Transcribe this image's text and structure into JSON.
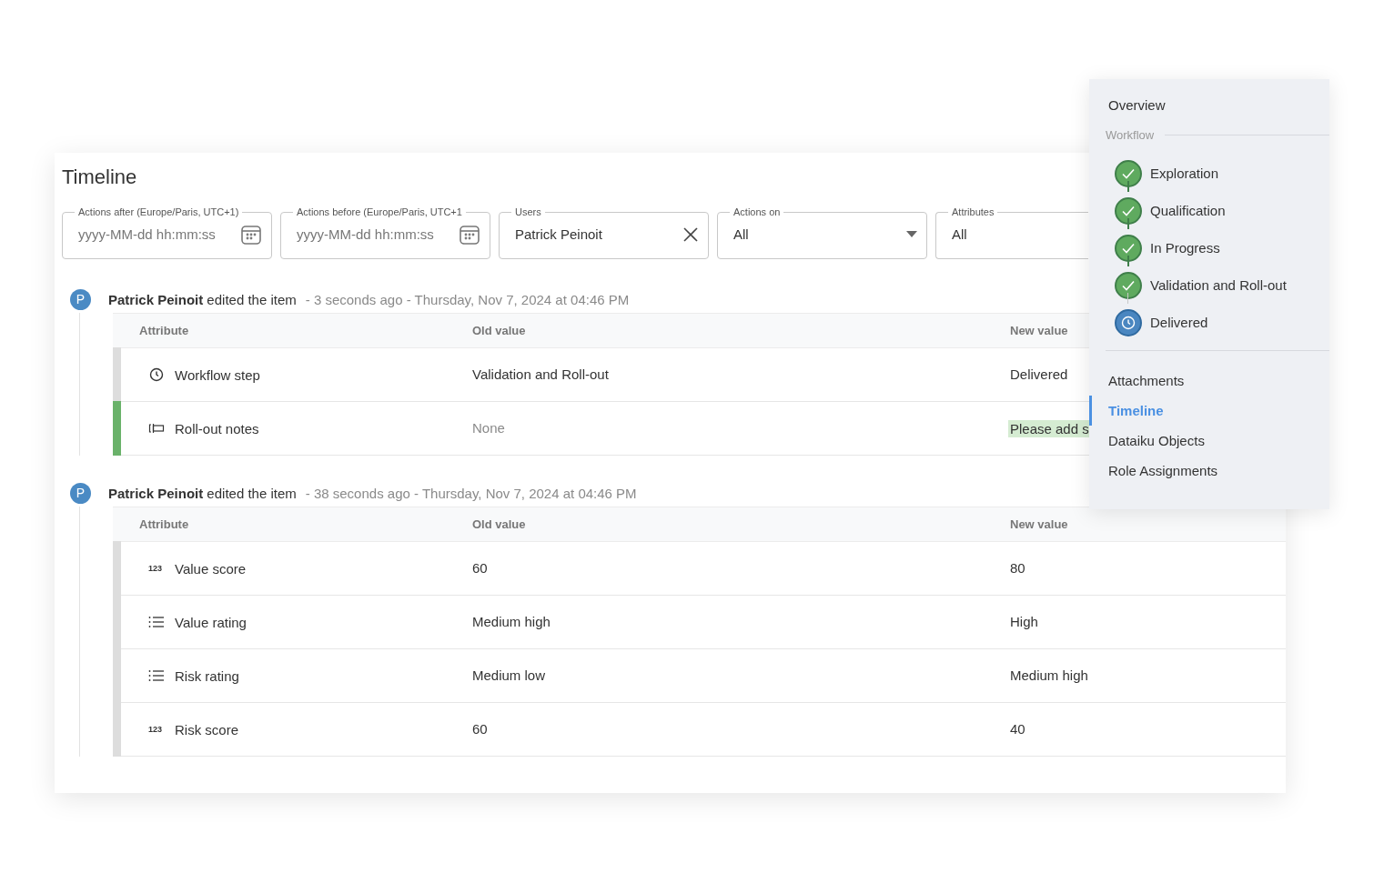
{
  "page_title": "Timeline",
  "filters": [
    {
      "kind": "date",
      "label": "Actions after (Europe/Paris, UTC+1)",
      "placeholder": "yyyy-MM-dd hh:mm:ss"
    },
    {
      "kind": "date",
      "label": "Actions before (Europe/Paris, UTC+1",
      "placeholder": "yyyy-MM-dd hh:mm:ss"
    },
    {
      "kind": "clearable",
      "label": "Users",
      "value": "Patrick Peinoit"
    },
    {
      "kind": "select",
      "label": "Actions on",
      "value": "All"
    },
    {
      "kind": "cut",
      "label": "Attributes",
      "value": "All"
    }
  ],
  "events": [
    {
      "avatar": "P",
      "user": "Patrick Peinoit",
      "action": "edited the item",
      "time": "- 3 seconds ago - Thursday, Nov 7, 2024 at 04:46 PM",
      "columns": [
        "Attribute",
        "Old value",
        "New value"
      ],
      "rows": [
        {
          "kind": "clock",
          "attribute": "Workflow step",
          "old_value": "Validation and Roll-out",
          "old_muted": false,
          "new_value": "Delivered",
          "new_added": false,
          "color": "#dddddd"
        },
        {
          "kind": "text",
          "attribute": "Roll-out notes",
          "old_value": "None",
          "old_muted": true,
          "new_value": "Please add s",
          "new_added": true,
          "color": "#6ab26a"
        }
      ]
    },
    {
      "avatar": "P",
      "user": "Patrick Peinoit",
      "action": "edited the item",
      "time": "- 38 seconds ago - Thursday, Nov 7, 2024 at 04:46 PM",
      "columns": [
        "Attribute",
        "Old value",
        "New value"
      ],
      "rows": [
        {
          "kind": "number",
          "icon_label": "123",
          "attribute": "Value score",
          "old_value": "60",
          "old_muted": false,
          "new_value": "80",
          "new_added": false,
          "color": "#dddddd"
        },
        {
          "kind": "list",
          "attribute": "Value rating",
          "old_value": "Medium high",
          "old_muted": false,
          "new_value": "High",
          "new_added": false,
          "color": "#dddddd"
        },
        {
          "kind": "list",
          "attribute": "Risk rating",
          "old_value": "Medium low",
          "old_muted": false,
          "new_value": "Medium high",
          "new_added": false,
          "color": "#dddddd"
        },
        {
          "kind": "number",
          "icon_label": "123",
          "attribute": "Risk score",
          "old_value": "60",
          "old_muted": false,
          "new_value": "40",
          "new_added": false,
          "color": "#dddddd"
        }
      ]
    }
  ],
  "side_nav": {
    "overview": {
      "label": "Overview",
      "selected": false
    },
    "workflow": {
      "heading": "Workflow",
      "steps": [
        {
          "label": "Exploration",
          "kind": "done"
        },
        {
          "label": "Qualification",
          "kind": "done"
        },
        {
          "label": "In Progress",
          "kind": "done"
        },
        {
          "label": "Validation and Roll-out",
          "kind": "done"
        },
        {
          "label": "Delivered",
          "kind": "current"
        }
      ]
    },
    "items": [
      {
        "label": "Attachments",
        "selected": false
      },
      {
        "label": "Timeline",
        "selected": true
      },
      {
        "label": "Dataiku Objects",
        "selected": false
      },
      {
        "label": "Role Assignments",
        "selected": false
      }
    ]
  }
}
